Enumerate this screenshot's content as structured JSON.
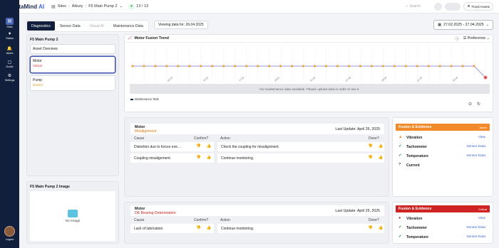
{
  "app": {
    "logo_mark": "◆",
    "logo_main": "DataMind",
    "logo_ai": " AI"
  },
  "breadcrumb": {
    "sites": "Sites",
    "site": "Albury",
    "asset": "F5 Main Pump 2",
    "count": "13 / 13",
    "sep": "›"
  },
  "topbar": {
    "search_placeholder": "Search",
    "fixed_assets": "Fixed Assets"
  },
  "sidebar": {
    "items": [
      {
        "label": "Sites",
        "icon": "▤"
      },
      {
        "label": "Status",
        "icon": "♥"
      },
      {
        "label": "Alerts",
        "icon": "🔔"
      },
      {
        "label": "Guide",
        "icon": "▢"
      },
      {
        "label": "Settings",
        "icon": "⚙"
      }
    ],
    "logout": "Logout"
  },
  "tabs": [
    "Diagnostics",
    "Sensor Data",
    "Visual AI",
    "Maintenance Data"
  ],
  "viewing": "Viewing data for: 26.04.2025",
  "date_range": "27.02.2025 - 27.04.2025",
  "asset_panel": {
    "title": "F5 Main Pump 2",
    "items": [
      {
        "name": "Asset Overview",
        "status": ""
      },
      {
        "name": "Motor",
        "status": "Critical"
      },
      {
        "name": "Pump",
        "status": "Monitor"
      }
    ]
  },
  "image_panel": {
    "title": "F5 Main Pump 2 Image",
    "no_image": "No Image"
  },
  "trend": {
    "title": "Motor Fusion Trend",
    "preference": "Preference",
    "no_data": "No maintenance data available. Please upload data in order to see it.",
    "legend": "Maintenance Task",
    "x_labels": [
      "03.03",
      "10.03",
      "17.03",
      "24.03",
      "31.03",
      "07.04",
      "14.04",
      "21.04",
      "28.04",
      "04.05"
    ]
  },
  "chart_data": {
    "type": "line",
    "title": "Motor Fusion Trend",
    "xlabel": "",
    "ylabel": "",
    "grid": true,
    "series": [
      {
        "values": [
          1,
          1,
          1,
          1,
          1,
          1,
          1,
          1,
          1,
          1,
          1,
          1,
          1,
          1,
          1,
          1,
          1,
          1,
          1,
          1,
          1,
          1,
          1,
          1,
          1,
          1,
          1,
          1,
          1,
          1,
          1,
          0
        ]
      }
    ],
    "point_colors": [
      "orange",
      "orange",
      "orange",
      "orange",
      "orange",
      "orange",
      "orange",
      "orange",
      "orange",
      "orange",
      "orange",
      "orange",
      "orange",
      "orange",
      "orange",
      "orange",
      "orange",
      "orange",
      "orange",
      "orange",
      "orange",
      "orange",
      "orange",
      "orange",
      "orange",
      "orange",
      "orange",
      "orange",
      "orange",
      "orange",
      "orange",
      "red"
    ]
  },
  "issues": [
    {
      "component": "Motor",
      "fault": "Misalignment",
      "severity_color": "#e27a12",
      "last_update": "Last Update: April 26, 2025",
      "headers": {
        "cause": "Cause",
        "confirm": "Confirm?",
        "action": "Action",
        "done": "Done?"
      },
      "rows": [
        {
          "cause": "Distortion due to forces exe...",
          "action": "Check the coupling for misalignment.",
          "done_up": "green"
        },
        {
          "cause": "Coupling misalignment.",
          "action": "Continue monitoring.",
          "done_up": ""
        }
      ]
    },
    {
      "component": "Motor",
      "fault": "DE Bearing Deterioration",
      "severity_color": "#cf2323",
      "last_update": "Last Update: April 26, 2025",
      "headers": {
        "cause": "Cause",
        "confirm": "Confirm?",
        "action": "Action",
        "done": "Done?"
      },
      "rows": [
        {
          "cause": "Lack of lubrication.",
          "action": "Continue monitoring.",
          "done_up": "",
          "confirm_down": "red"
        }
      ]
    }
  ],
  "fusion": [
    {
      "title": "Fusion & Evidence",
      "tag": "Alarm",
      "items": [
        {
          "name": "Vibration",
          "link": "View",
          "mark": "▲",
          "color": "orange"
        },
        {
          "name": "Tachometer",
          "link": "Sensor Data",
          "mark": "✔",
          "color": "green"
        },
        {
          "name": "Temperature",
          "link": "Sensor Data",
          "mark": "✔",
          "color": "green"
        },
        {
          "name": "Current",
          "link": "",
          "mark": "?",
          "color": "black"
        }
      ]
    },
    {
      "title": "Fusion & Evidence",
      "tag": "Critical",
      "items": [
        {
          "name": "Vibration",
          "link": "View",
          "mark": "●",
          "color": "red"
        },
        {
          "name": "Tachometer",
          "link": "Sensor Data",
          "mark": "✔",
          "color": "green"
        },
        {
          "name": "Temperature",
          "link": "Sensor Data",
          "mark": "✔",
          "color": "green"
        }
      ]
    }
  ]
}
